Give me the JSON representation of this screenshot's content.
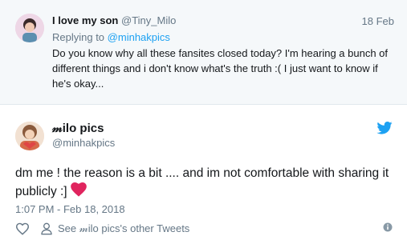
{
  "reply": {
    "name": "I love my son",
    "handle": "@Tiny_Milo",
    "date": "18 Feb",
    "replying_prefix": "Replying to",
    "replying_to": "@minhakpics",
    "text": "Do you know why all these fansites closed today? I'm hearing a bunch of different things and i don't know what's the truth :( I just want to know if he's okay..."
  },
  "tweet": {
    "name": "𝓂ilo pics",
    "handle": "@minhakpics",
    "text": "dm me ! the reason is a bit .... and im not comfortable with sharing it publicly :] ",
    "timestamp": "1:07 PM - Feb 18, 2018",
    "other_tweets": "See 𝓂ilo pics's other Tweets"
  },
  "colors": {
    "accent": "#1da1f2",
    "heart": "#e0245e",
    "muted": "#657786",
    "reply_bg": "#f5f8fa"
  },
  "icons": [
    "twitter-bird-icon",
    "heart-icon",
    "like-icon",
    "profile-icon",
    "info-icon"
  ]
}
